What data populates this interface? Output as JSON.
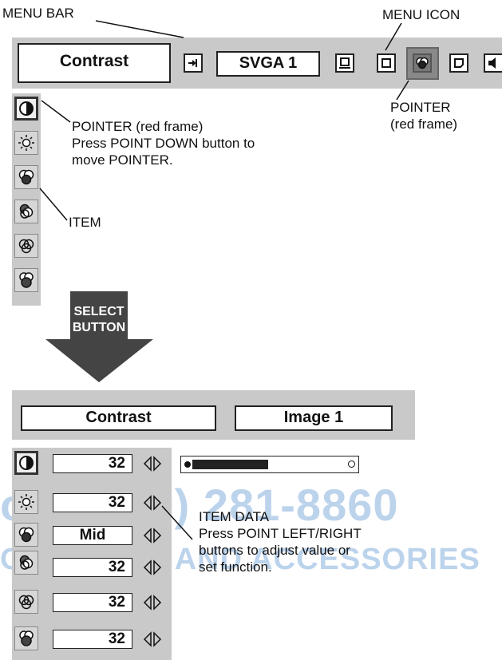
{
  "callouts": {
    "menu_bar": "MENU BAR",
    "menu_icon": "MENU ICON",
    "pointer_right_1": "POINTER",
    "pointer_right_2": "(red frame)",
    "pointer_left_1": "POINTER (red frame)",
    "pointer_left_2": "Press POINT DOWN button to",
    "pointer_left_3": "move POINTER.",
    "item": "ITEM",
    "item_data_1": "ITEM DATA",
    "item_data_2": "Press POINT LEFT/RIGHT",
    "item_data_3": "buttons to adjust value or",
    "item_data_4": "set function."
  },
  "top_menu": {
    "title": "Contrast",
    "source": "SVGA 1",
    "icons": [
      "input-icon",
      "screen-icon",
      "square-icon",
      "image-adjust-icon",
      "page-icon",
      "sound-icon"
    ]
  },
  "left_icons": [
    "contrast-icon",
    "brightness-icon",
    "color-icon",
    "tint-icon",
    "white-balance-icon",
    "sharpness-icon"
  ],
  "arrow": {
    "line1": "SELECT",
    "line2": "BUTTON"
  },
  "bottom_menu": {
    "title": "Contrast",
    "image": "Image 1",
    "items": [
      {
        "icon": "contrast-icon",
        "value": "32"
      },
      {
        "icon": "brightness-icon",
        "value": "32"
      },
      {
        "icon": "color-icon",
        "value": "Mid"
      },
      {
        "icon": "tint-icon",
        "value": "32"
      },
      {
        "icon": "white-balance-icon",
        "value": "32"
      },
      {
        "icon": "sharpness-icon",
        "value": "32"
      }
    ],
    "slider_level": 0.5
  },
  "watermark": {
    "line1": "om (800) 281-8860",
    "line2": "OR LAMPS AND ACCESSORIES"
  }
}
